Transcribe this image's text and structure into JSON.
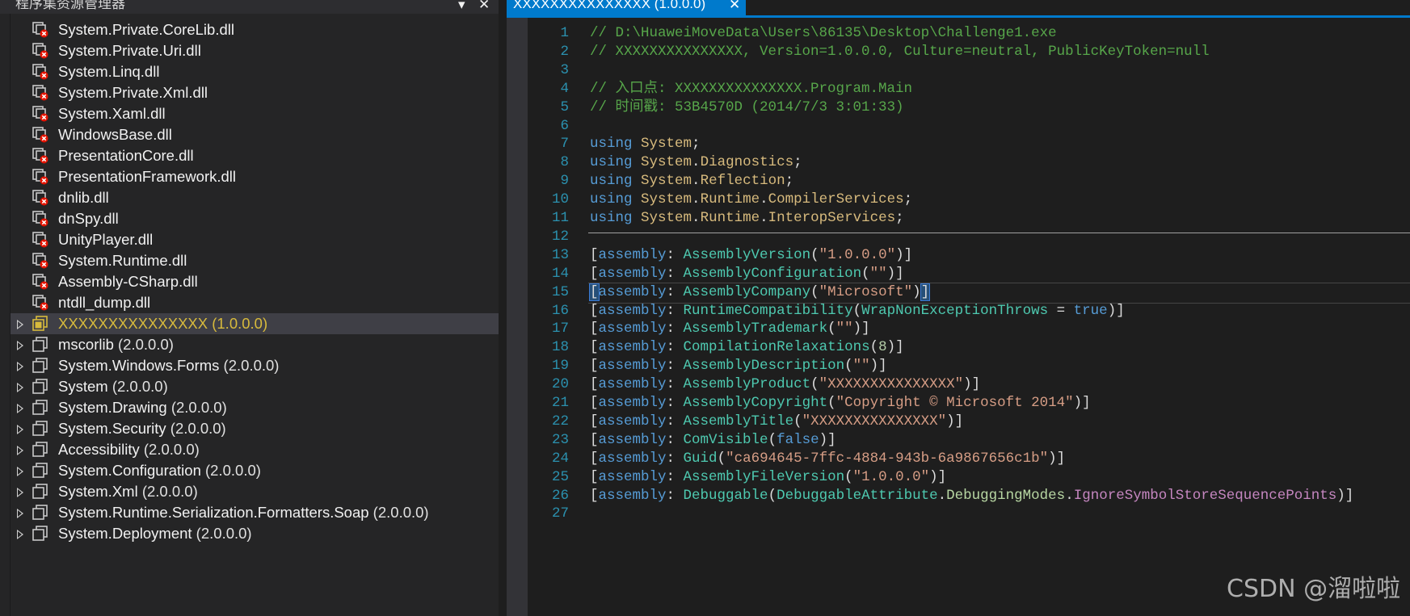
{
  "explorer": {
    "title": "程序集资源管理器",
    "dropdown_glyph": "▾",
    "close_glyph": "✕",
    "items": [
      {
        "label": "System.Private.CoreLib.dll",
        "version": "",
        "icon": "dll-error-icon",
        "expandable": false
      },
      {
        "label": "System.Private.Uri.dll",
        "version": "",
        "icon": "dll-error-icon",
        "expandable": false
      },
      {
        "label": "System.Linq.dll",
        "version": "",
        "icon": "dll-error-icon",
        "expandable": false
      },
      {
        "label": "System.Private.Xml.dll",
        "version": "",
        "icon": "dll-error-icon",
        "expandable": false
      },
      {
        "label": "System.Xaml.dll",
        "version": "",
        "icon": "dll-error-icon",
        "expandable": false
      },
      {
        "label": "WindowsBase.dll",
        "version": "",
        "icon": "dll-error-icon",
        "expandable": false
      },
      {
        "label": "PresentationCore.dll",
        "version": "",
        "icon": "dll-error-icon",
        "expandable": false
      },
      {
        "label": "PresentationFramework.dll",
        "version": "",
        "icon": "dll-error-icon",
        "expandable": false
      },
      {
        "label": "dnlib.dll",
        "version": "",
        "icon": "dll-error-icon",
        "expandable": false
      },
      {
        "label": "dnSpy.dll",
        "version": "",
        "icon": "dll-error-icon",
        "expandable": false
      },
      {
        "label": "UnityPlayer.dll",
        "version": "",
        "icon": "dll-error-icon",
        "expandable": false
      },
      {
        "label": "System.Runtime.dll",
        "version": "",
        "icon": "dll-error-icon",
        "expandable": false
      },
      {
        "label": "Assembly-CSharp.dll",
        "version": "",
        "icon": "dll-error-icon",
        "expandable": false
      },
      {
        "label": "ntdll_dump.dll",
        "version": "",
        "icon": "dll-error-icon",
        "expandable": false
      },
      {
        "label": "XXXXXXXXXXXXXXX",
        "version": " (1.0.0.0)",
        "icon": "assembly-icon",
        "expandable": true,
        "selected": true
      },
      {
        "label": "mscorlib",
        "version": " (2.0.0.0)",
        "icon": "assembly-icon",
        "expandable": true
      },
      {
        "label": "System.Windows.Forms",
        "version": " (2.0.0.0)",
        "icon": "assembly-icon",
        "expandable": true
      },
      {
        "label": "System",
        "version": " (2.0.0.0)",
        "icon": "assembly-icon",
        "expandable": true
      },
      {
        "label": "System.Drawing",
        "version": " (2.0.0.0)",
        "icon": "assembly-icon",
        "expandable": true
      },
      {
        "label": "System.Security",
        "version": " (2.0.0.0)",
        "icon": "assembly-icon",
        "expandable": true
      },
      {
        "label": "Accessibility",
        "version": " (2.0.0.0)",
        "icon": "assembly-icon",
        "expandable": true
      },
      {
        "label": "System.Configuration",
        "version": " (2.0.0.0)",
        "icon": "assembly-icon",
        "expandable": true
      },
      {
        "label": "System.Xml",
        "version": " (2.0.0.0)",
        "icon": "assembly-icon",
        "expandable": true
      },
      {
        "label": "System.Runtime.Serialization.Formatters.Soap",
        "version": " (2.0.0.0)",
        "icon": "assembly-icon",
        "expandable": true
      },
      {
        "label": "System.Deployment",
        "version": " (2.0.0.0)",
        "icon": "assembly-icon",
        "expandable": true
      }
    ]
  },
  "editor": {
    "tab_label": "XXXXXXXXXXXXXXX (1.0.0.0)",
    "tab_close_glyph": "✕",
    "current_line": 15,
    "lines": [
      {
        "n": "1",
        "tokens": [
          [
            "t-comment",
            "// D:\\HuaweiMoveData\\Users\\86135\\Desktop\\Challenge1.exe"
          ]
        ]
      },
      {
        "n": "2",
        "tokens": [
          [
            "t-comment",
            "// XXXXXXXXXXXXXXX, Version=1.0.0.0, Culture=neutral, PublicKeyToken=null"
          ]
        ]
      },
      {
        "n": "3",
        "tokens": []
      },
      {
        "n": "4",
        "tokens": [
          [
            "t-comment",
            "// 入口点: XXXXXXXXXXXXXXX.Program.Main"
          ]
        ]
      },
      {
        "n": "5",
        "tokens": [
          [
            "t-comment",
            "// 时间戳: 53B4570D (2014/7/3 3:01:33)"
          ]
        ]
      },
      {
        "n": "6",
        "tokens": []
      },
      {
        "n": "7",
        "tokens": [
          [
            "t-keyword",
            "using"
          ],
          [
            "t-punct",
            " "
          ],
          [
            "t-ns",
            "System"
          ],
          [
            "t-punct",
            ";"
          ]
        ]
      },
      {
        "n": "8",
        "tokens": [
          [
            "t-keyword",
            "using"
          ],
          [
            "t-punct",
            " "
          ],
          [
            "t-ns",
            "System"
          ],
          [
            "t-punct",
            "."
          ],
          [
            "t-ns",
            "Diagnostics"
          ],
          [
            "t-punct",
            ";"
          ]
        ]
      },
      {
        "n": "9",
        "tokens": [
          [
            "t-keyword",
            "using"
          ],
          [
            "t-punct",
            " "
          ],
          [
            "t-ns",
            "System"
          ],
          [
            "t-punct",
            "."
          ],
          [
            "t-ns",
            "Reflection"
          ],
          [
            "t-punct",
            ";"
          ]
        ]
      },
      {
        "n": "10",
        "tokens": [
          [
            "t-keyword",
            "using"
          ],
          [
            "t-punct",
            " "
          ],
          [
            "t-ns",
            "System"
          ],
          [
            "t-punct",
            "."
          ],
          [
            "t-ns",
            "Runtime"
          ],
          [
            "t-punct",
            "."
          ],
          [
            "t-ns",
            "CompilerServices"
          ],
          [
            "t-punct",
            ";"
          ]
        ]
      },
      {
        "n": "11",
        "tokens": [
          [
            "t-keyword",
            "using"
          ],
          [
            "t-punct",
            " "
          ],
          [
            "t-ns",
            "System"
          ],
          [
            "t-punct",
            "."
          ],
          [
            "t-ns",
            "Runtime"
          ],
          [
            "t-punct",
            "."
          ],
          [
            "t-ns",
            "InteropServices"
          ],
          [
            "t-punct",
            ";"
          ]
        ]
      },
      {
        "n": "12",
        "tokens": []
      },
      {
        "n": "13",
        "tokens": [
          [
            "t-punct",
            "["
          ],
          [
            "t-keyword",
            "assembly"
          ],
          [
            "t-punct",
            ": "
          ],
          [
            "t-type",
            "AssemblyVersion"
          ],
          [
            "t-punct",
            "("
          ],
          [
            "t-string",
            "\"1.0.0.0\""
          ],
          [
            "t-punct",
            ")]"
          ]
        ]
      },
      {
        "n": "14",
        "tokens": [
          [
            "t-punct",
            "["
          ],
          [
            "t-keyword",
            "assembly"
          ],
          [
            "t-punct",
            ": "
          ],
          [
            "t-type",
            "AssemblyConfiguration"
          ],
          [
            "t-punct",
            "("
          ],
          [
            "t-string",
            "\"\""
          ],
          [
            "t-punct",
            ")]"
          ]
        ]
      },
      {
        "n": "15",
        "tokens": [
          [
            "bracket-hl",
            "["
          ],
          [
            "t-keyword",
            "assembly"
          ],
          [
            "t-punct",
            ": "
          ],
          [
            "t-type",
            "AssemblyCompany"
          ],
          [
            "t-punct",
            "("
          ],
          [
            "t-string",
            "\"Microsoft\""
          ],
          [
            "t-punct",
            ")"
          ],
          [
            "bracket-hl",
            "]"
          ]
        ]
      },
      {
        "n": "16",
        "tokens": [
          [
            "t-punct",
            "["
          ],
          [
            "t-keyword",
            "assembly"
          ],
          [
            "t-punct",
            ": "
          ],
          [
            "t-type",
            "RuntimeCompatibility"
          ],
          [
            "t-punct",
            "("
          ],
          [
            "t-prop",
            "WrapNonExceptionThrows"
          ],
          [
            "t-punct",
            " = "
          ],
          [
            "t-keyword",
            "true"
          ],
          [
            "t-punct",
            ")]"
          ]
        ]
      },
      {
        "n": "17",
        "tokens": [
          [
            "t-punct",
            "["
          ],
          [
            "t-keyword",
            "assembly"
          ],
          [
            "t-punct",
            ": "
          ],
          [
            "t-type",
            "AssemblyTrademark"
          ],
          [
            "t-punct",
            "("
          ],
          [
            "t-string",
            "\"\""
          ],
          [
            "t-punct",
            ")]"
          ]
        ]
      },
      {
        "n": "18",
        "tokens": [
          [
            "t-punct",
            "["
          ],
          [
            "t-keyword",
            "assembly"
          ],
          [
            "t-punct",
            ": "
          ],
          [
            "t-type",
            "CompilationRelaxations"
          ],
          [
            "t-punct",
            "("
          ],
          [
            "t-number",
            "8"
          ],
          [
            "t-punct",
            ")]"
          ]
        ]
      },
      {
        "n": "19",
        "tokens": [
          [
            "t-punct",
            "["
          ],
          [
            "t-keyword",
            "assembly"
          ],
          [
            "t-punct",
            ": "
          ],
          [
            "t-type",
            "AssemblyDescription"
          ],
          [
            "t-punct",
            "("
          ],
          [
            "t-string",
            "\"\""
          ],
          [
            "t-punct",
            ")]"
          ]
        ]
      },
      {
        "n": "20",
        "tokens": [
          [
            "t-punct",
            "["
          ],
          [
            "t-keyword",
            "assembly"
          ],
          [
            "t-punct",
            ": "
          ],
          [
            "t-type",
            "AssemblyProduct"
          ],
          [
            "t-punct",
            "("
          ],
          [
            "t-string",
            "\"XXXXXXXXXXXXXXX\""
          ],
          [
            "t-punct",
            ")]"
          ]
        ]
      },
      {
        "n": "21",
        "tokens": [
          [
            "t-punct",
            "["
          ],
          [
            "t-keyword",
            "assembly"
          ],
          [
            "t-punct",
            ": "
          ],
          [
            "t-type",
            "AssemblyCopyright"
          ],
          [
            "t-punct",
            "("
          ],
          [
            "t-string",
            "\"Copyright © Microsoft 2014\""
          ],
          [
            "t-punct",
            ")]"
          ]
        ]
      },
      {
        "n": "22",
        "tokens": [
          [
            "t-punct",
            "["
          ],
          [
            "t-keyword",
            "assembly"
          ],
          [
            "t-punct",
            ": "
          ],
          [
            "t-type",
            "AssemblyTitle"
          ],
          [
            "t-punct",
            "("
          ],
          [
            "t-string",
            "\"XXXXXXXXXXXXXXX\""
          ],
          [
            "t-punct",
            ")]"
          ]
        ]
      },
      {
        "n": "23",
        "tokens": [
          [
            "t-punct",
            "["
          ],
          [
            "t-keyword",
            "assembly"
          ],
          [
            "t-punct",
            ": "
          ],
          [
            "t-type",
            "ComVisible"
          ],
          [
            "t-punct",
            "("
          ],
          [
            "t-keyword",
            "false"
          ],
          [
            "t-punct",
            ")]"
          ]
        ]
      },
      {
        "n": "24",
        "tokens": [
          [
            "t-punct",
            "["
          ],
          [
            "t-keyword",
            "assembly"
          ],
          [
            "t-punct",
            ": "
          ],
          [
            "t-type",
            "Guid"
          ],
          [
            "t-punct",
            "("
          ],
          [
            "t-string",
            "\"ca694645-7ffc-4884-943b-6a9867656c1b\""
          ],
          [
            "t-punct",
            ")]"
          ]
        ]
      },
      {
        "n": "25",
        "tokens": [
          [
            "t-punct",
            "["
          ],
          [
            "t-keyword",
            "assembly"
          ],
          [
            "t-punct",
            ": "
          ],
          [
            "t-type",
            "AssemblyFileVersion"
          ],
          [
            "t-punct",
            "("
          ],
          [
            "t-string",
            "\"1.0.0.0\""
          ],
          [
            "t-punct",
            ")]"
          ]
        ]
      },
      {
        "n": "26",
        "tokens": [
          [
            "t-punct",
            "["
          ],
          [
            "t-keyword",
            "assembly"
          ],
          [
            "t-punct",
            ": "
          ],
          [
            "t-type",
            "Debuggable"
          ],
          [
            "t-punct",
            "("
          ],
          [
            "t-type",
            "DebuggableAttribute"
          ],
          [
            "t-punct",
            "."
          ],
          [
            "t-enum",
            "DebuggingModes"
          ],
          [
            "t-punct",
            "."
          ],
          [
            "t-enumval",
            "IgnoreSymbolStoreSequencePoints"
          ],
          [
            "t-punct",
            ")]"
          ]
        ]
      },
      {
        "n": "27",
        "tokens": []
      }
    ]
  },
  "watermark": "CSDN @溜啦啦",
  "colors": {
    "accent": "#007acc",
    "background": "#1e1e1e",
    "panel": "#252526",
    "selection": "#3f3f46",
    "highlight_text": "#d7ba3c"
  }
}
